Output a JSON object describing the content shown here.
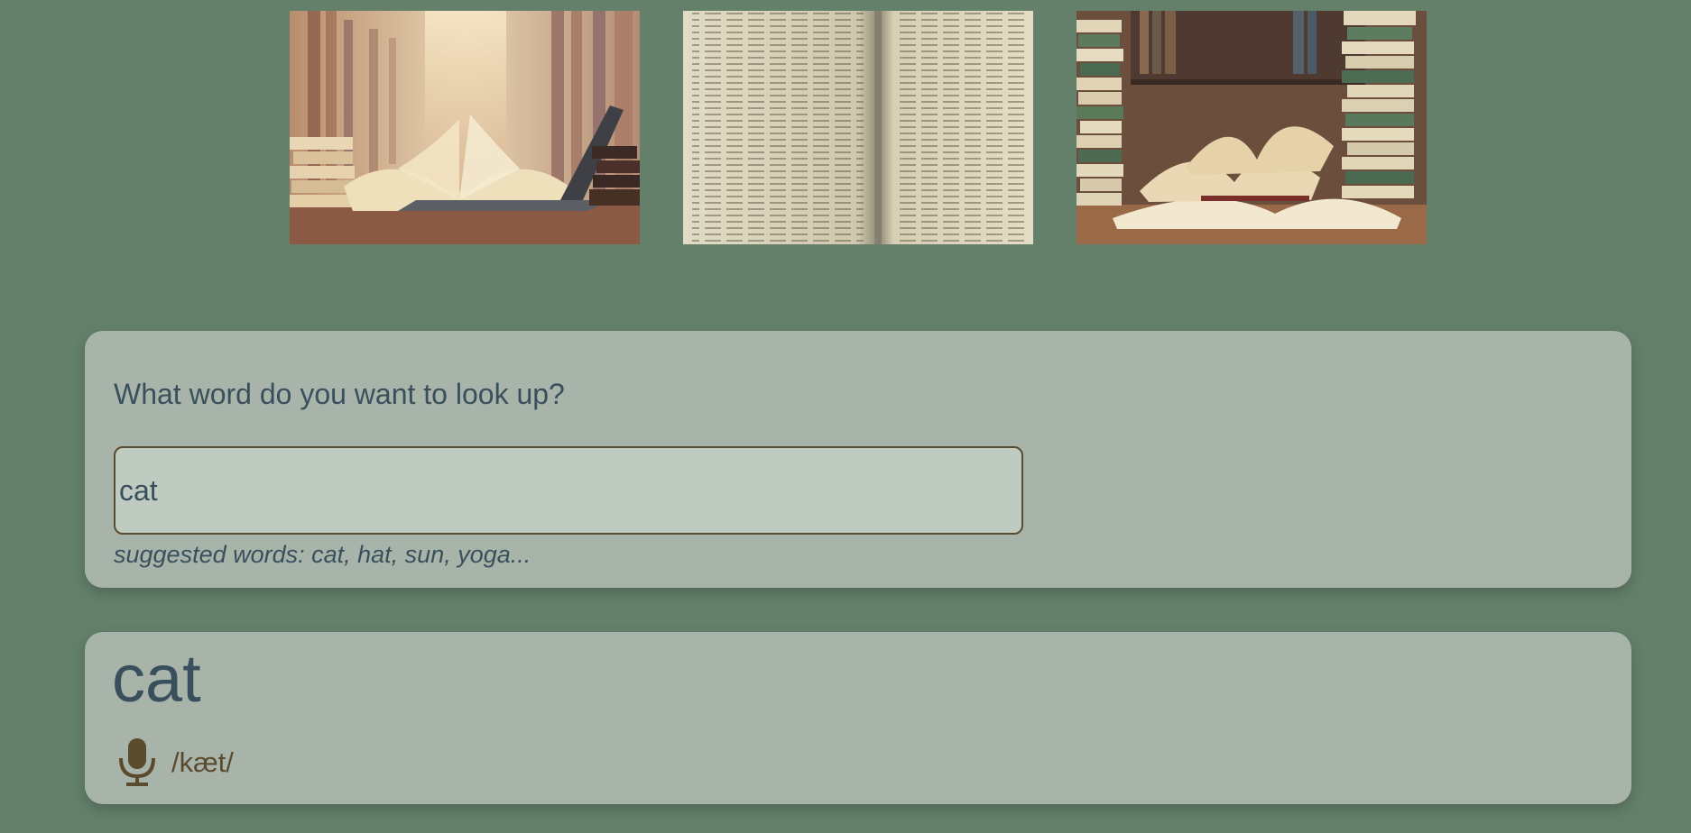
{
  "gallery": {
    "photos": [
      {
        "icon": "library-books-laptop-photo"
      },
      {
        "icon": "dictionary-pages-photo"
      },
      {
        "icon": "stacked-books-photo"
      }
    ]
  },
  "search": {
    "heading": "What word do you want to look up?",
    "value": "cat",
    "hint": "suggested words: cat, hat, sun, yoga..."
  },
  "result": {
    "word": "cat",
    "phonetic": "/kæt/",
    "audio_icon": "microphone-icon"
  },
  "colors": {
    "background": "#64806b",
    "card": "#a8b4aa",
    "text": "#39505c",
    "accent_brown": "#5a4a2e"
  }
}
